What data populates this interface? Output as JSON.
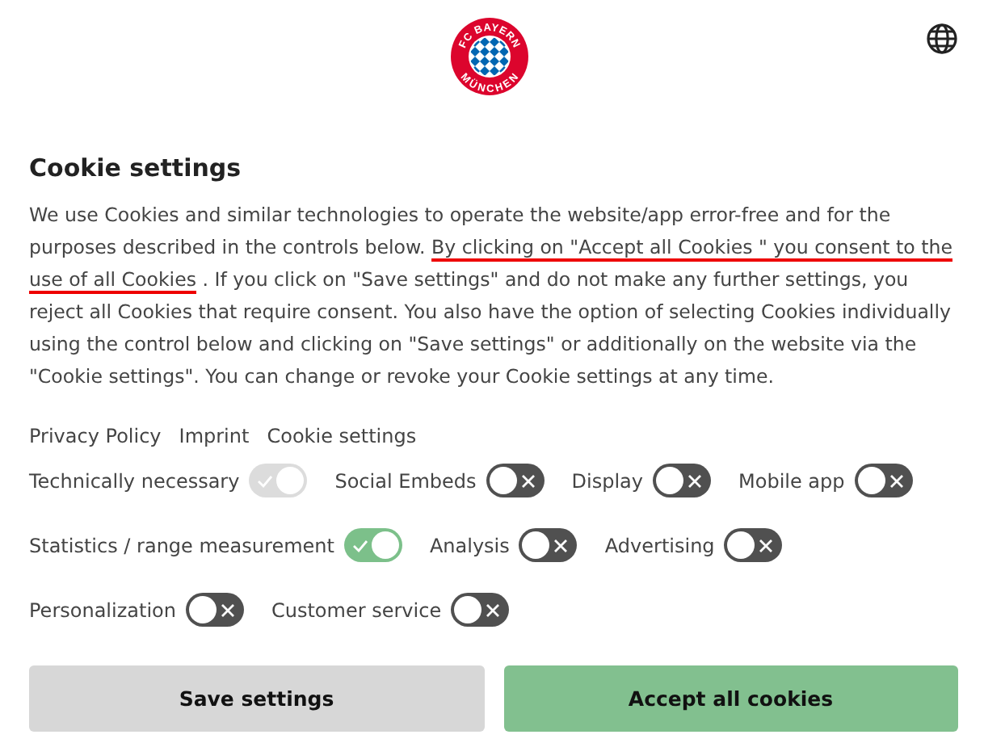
{
  "header": {
    "logo_top": "FC BAYERN",
    "logo_bottom": "MÜNCHEN"
  },
  "title": "Cookie settings",
  "intro": {
    "before": "We use Cookies and similar technologies to operate the website/app error-free and for the purposes described in the controls below. ",
    "underlined": "By clicking on \"Accept all Cookies \" you consent to the use of all Cookies",
    "after": " . If you click on \"Save settings\" and do not make any further settings, you reject all Cookies that require consent. You also have the option of selecting Cookies individually using the control below and clicking on \"Save settings\" or additionally on the website via the \"Cookie settings\". You can change or revoke your Cookie settings at any time."
  },
  "links": [
    "Privacy Policy",
    "Imprint",
    "Cookie settings"
  ],
  "toggle_rows": [
    [
      {
        "label": "Technically necessary",
        "checked": true,
        "disabled": true
      },
      {
        "label": "Social Embeds",
        "checked": false,
        "disabled": false
      },
      {
        "label": "Display",
        "checked": false,
        "disabled": false
      },
      {
        "label": "Mobile app",
        "checked": false,
        "disabled": false
      }
    ],
    [
      {
        "label": "Statistics / range measurement",
        "checked": true,
        "disabled": false
      },
      {
        "label": "Analysis",
        "checked": false,
        "disabled": false
      },
      {
        "label": "Advertising",
        "checked": false,
        "disabled": false
      }
    ],
    [
      {
        "label": "Personalization",
        "checked": false,
        "disabled": false
      },
      {
        "label": "Customer service",
        "checked": false,
        "disabled": false
      }
    ]
  ],
  "buttons": [
    {
      "label": "Save settings",
      "kind": "secondary"
    },
    {
      "label": "Accept all cookies",
      "kind": "primary"
    }
  ]
}
